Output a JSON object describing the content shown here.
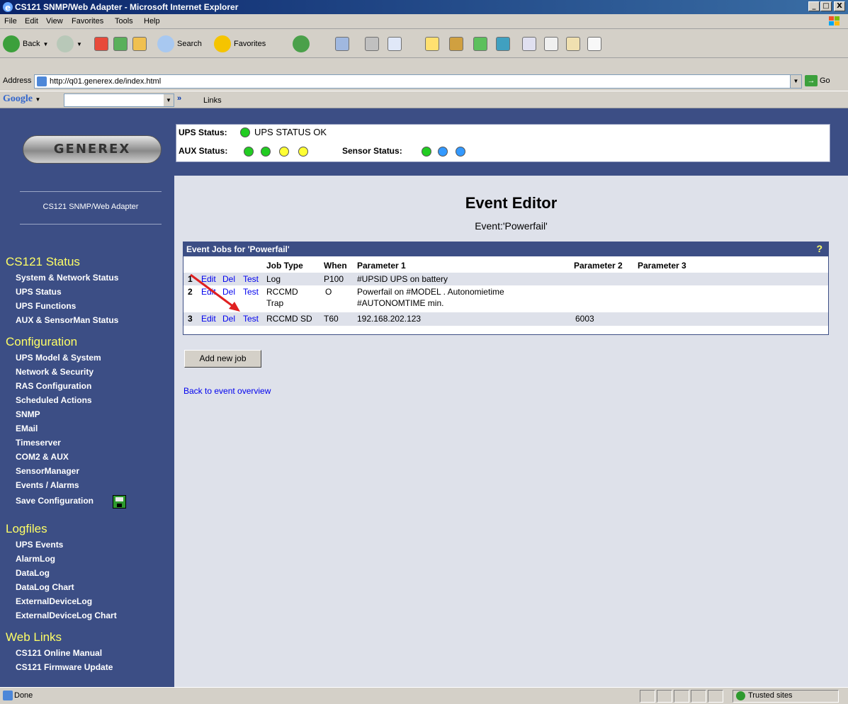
{
  "window": {
    "title": "CS121 SNMP/Web Adapter - Microsoft Internet Explorer",
    "minimize": "_",
    "maximize": "□",
    "close": "X"
  },
  "menu": [
    "File",
    "Edit",
    "View",
    "Favorites",
    "Tools",
    "Help"
  ],
  "toolbar": {
    "back": "Back",
    "search": "Search",
    "favorites": "Favorites"
  },
  "address": {
    "label": "Address",
    "url": "http://q01.generex.de/index.html",
    "go": "Go"
  },
  "googlebar": {
    "logo": "Google",
    "links": "Links",
    "chevron": "»"
  },
  "sidebar": {
    "logo": "GENEREX",
    "adapter_name": "CS121 SNMP/Web Adapter",
    "sections": [
      {
        "title": "CS121 Status",
        "items": [
          "System & Network Status",
          "UPS Status",
          "UPS Functions",
          "AUX & SensorMan Status"
        ]
      },
      {
        "title": "Configuration",
        "items": [
          "UPS Model & System",
          "Network & Security",
          "RAS Configuration",
          "Scheduled Actions",
          "SNMP",
          "EMail",
          "Timeserver",
          "COM2 & AUX",
          "SensorManager",
          "Events / Alarms",
          "Save Configuration"
        ]
      },
      {
        "title": "Logfiles",
        "items": [
          "UPS Events",
          "AlarmLog",
          "DataLog",
          "DataLog Chart",
          "ExternalDeviceLog",
          "ExternalDeviceLog Chart"
        ]
      },
      {
        "title": "Web Links",
        "items": [
          "CS121 Online Manual",
          "CS121 Firmware Update"
        ]
      }
    ]
  },
  "status": {
    "ups_label": "UPS Status:",
    "ups_text": "UPS STATUS OK",
    "aux_label": "AUX Status:",
    "sensor_label": "Sensor Status:",
    "colors": {
      "green": "#22cc22",
      "yellow": "#ffff33",
      "blue": "#3399ff"
    }
  },
  "editor": {
    "title": "Event Editor",
    "subtitle": "Event:'Powerfail'",
    "table_title": "Event Jobs for 'Powerfail'",
    "help": "?",
    "columns": [
      "Job Type",
      "When",
      "Parameter 1",
      "Parameter 2",
      "Parameter 3"
    ],
    "actions": [
      "Edit",
      "Del",
      "Test"
    ],
    "rows": [
      {
        "num": "1",
        "job_type": "Log",
        "job_type2": "",
        "when": "P100",
        "param1": "#UPSID UPS on battery",
        "param1b": "",
        "param2": "",
        "param3": ""
      },
      {
        "num": "2",
        "job_type": "RCCMD",
        "job_type2": "Trap",
        "when": "O",
        "param1": "Powerfail on #MODEL . Autonomietime",
        "param1b": "#AUTONOMTIME min.",
        "param2": "",
        "param3": ""
      },
      {
        "num": "3",
        "job_type": "RCCMD SD",
        "job_type2": "",
        "when": "T60",
        "param1": "192.168.202.123",
        "param1b": "",
        "param2": "6003",
        "param3": ""
      }
    ],
    "add_button": "Add new job",
    "back_link": "Back to event overview"
  },
  "statusbar": {
    "text": "Done",
    "zone": "Trusted sites"
  }
}
